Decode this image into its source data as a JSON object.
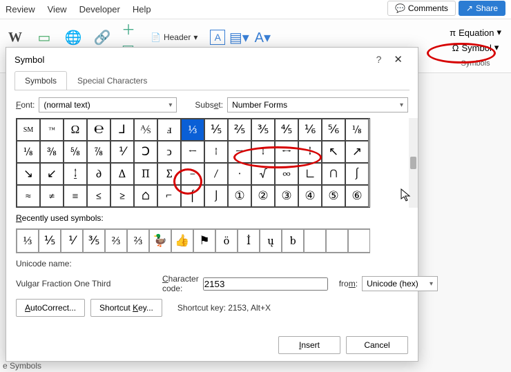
{
  "menubar": {
    "items": [
      "Review",
      "View",
      "Developer",
      "Help"
    ]
  },
  "topright": {
    "comments": "Comments",
    "share": "Share"
  },
  "ribbon": {
    "header": "Header",
    "equation": "Equation",
    "symbol": "Symbol",
    "group_label": "Symbols"
  },
  "dialog": {
    "title": "Symbol",
    "tabs": {
      "symbols": "Symbols",
      "special": "Special Characters"
    },
    "font_label": "Font:",
    "font_value": "(normal text)",
    "subset_label": "Subset:",
    "subset_value": "Number Forms",
    "grid": [
      [
        "SM",
        "™",
        "Ω",
        "℮",
        "⅃",
        "⅍",
        "ⅎ",
        "⅓",
        "⅕",
        "⅖",
        "⅗",
        "⅘",
        "⅙",
        "⅚",
        "⅛"
      ],
      [
        "⅛",
        "⅜",
        "⅝",
        "⅞",
        "⅟",
        "Ↄ",
        "ↄ",
        "←",
        "↑",
        "→",
        "↓",
        "↔",
        "↕",
        "↖",
        "↗"
      ],
      [
        "↘",
        "↙",
        "↨",
        "∂",
        "∆",
        "∏",
        "∑",
        "−",
        "∕",
        "∙",
        "√",
        "∞",
        "∟",
        "∩",
        "∫"
      ],
      [
        "≈",
        "≠",
        "≡",
        "≤",
        "≥",
        "⌂",
        "⌐",
        "⌠",
        "⌡",
        "①",
        "②",
        "③",
        "④",
        "⑤",
        "⑥"
      ]
    ],
    "selected_row": 0,
    "selected_col": 7,
    "recent_label": "Recently used symbols:",
    "recent": [
      "⅓",
      "⅕",
      "⅟",
      "⅗",
      "⅔",
      "⅔",
      "🦆",
      "👍",
      "⚑",
      "ö",
      "İ",
      "ų",
      "b",
      "",
      "",
      ""
    ],
    "unicode_name_label": "Unicode name:",
    "unicode_name": "Vulgar Fraction One Third",
    "char_code_label": "Character code:",
    "char_code": "2153",
    "from_label": "from:",
    "from_value": "Unicode (hex)",
    "autocorrect": "AutoCorrect...",
    "shortcut_key": "Shortcut Key...",
    "shortcut_text": "Shortcut key: 2153, Alt+X",
    "insert": "Insert",
    "cancel": "Cancel"
  },
  "footer_bar": "e Symbols"
}
